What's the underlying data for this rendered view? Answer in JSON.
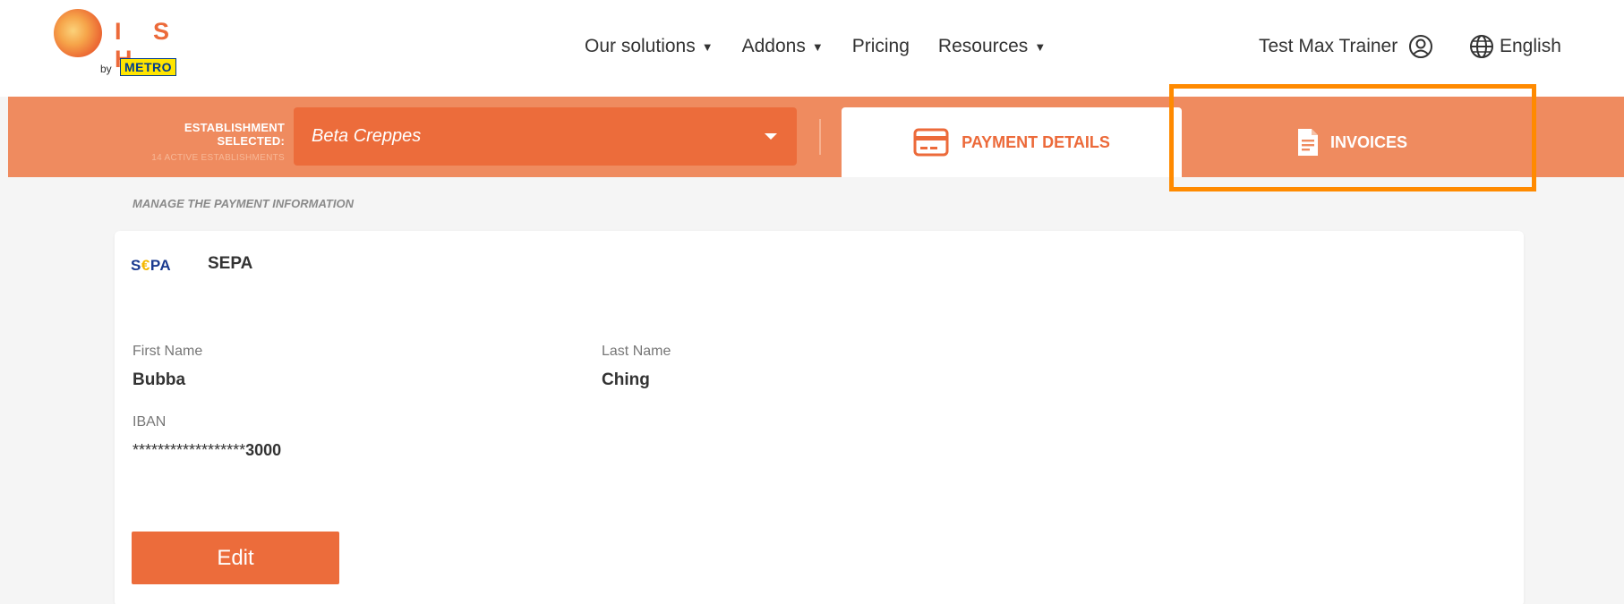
{
  "brand": {
    "letters": "I S H",
    "by": "by",
    "metro": "METRO"
  },
  "nav": {
    "items": [
      {
        "label": "Our solutions",
        "has_caret": true
      },
      {
        "label": "Addons",
        "has_caret": true
      },
      {
        "label": "Pricing",
        "has_caret": false
      },
      {
        "label": "Resources",
        "has_caret": true
      }
    ],
    "caret": "▼"
  },
  "user": {
    "name": "Test Max Trainer"
  },
  "language": {
    "label": "English"
  },
  "establishment": {
    "label": "ESTABLISHMENT SELECTED:",
    "count_text": "14 ACTIVE ESTABLISHMENTS",
    "selected": "Beta Creppes"
  },
  "tabs": {
    "payment": "PAYMENT DETAILS",
    "invoices": "INVOICES"
  },
  "section": {
    "title": "MANAGE THE PAYMENT INFORMATION"
  },
  "payment": {
    "method_logo": {
      "s": "S",
      "euro": "€",
      "pa": "PA"
    },
    "method_name": "SEPA",
    "first_name_label": "First Name",
    "first_name": "Bubba",
    "last_name_label": "Last Name",
    "last_name": "Ching",
    "iban_label": "IBAN",
    "iban_mask": "******************",
    "iban_last": "3000",
    "edit_label": "Edit"
  },
  "colors": {
    "brand_orange": "#ec6c3b",
    "band_orange": "#ef8b5f",
    "highlight": "#ff8a00"
  }
}
